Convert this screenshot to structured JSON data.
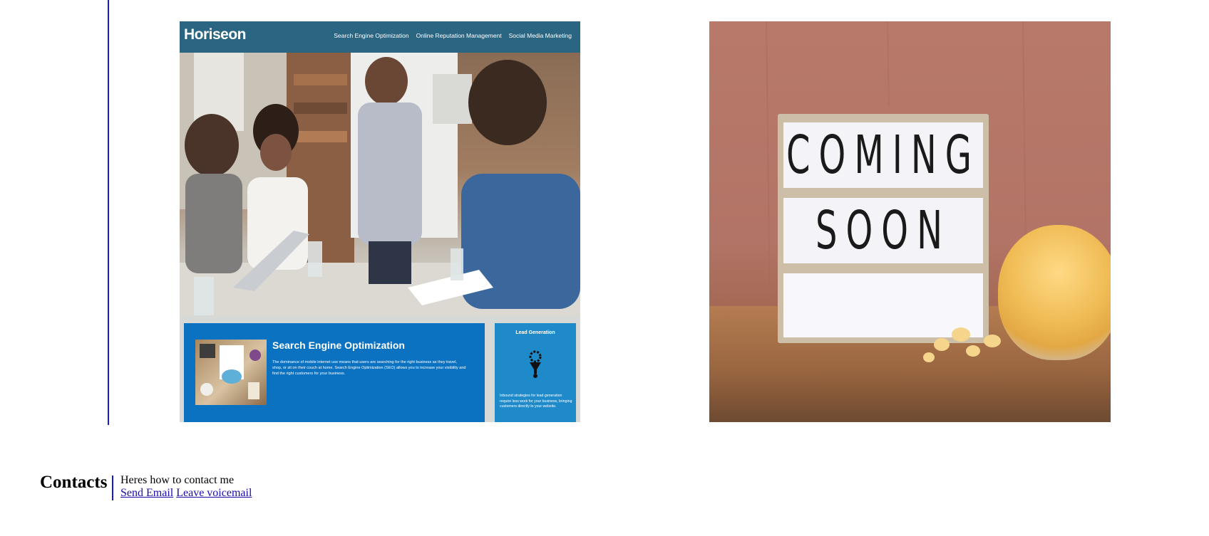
{
  "horiseon": {
    "logo": "Horiseon",
    "nav": [
      "Search Engine Optimization",
      "Online Reputation Management",
      "Social Media Marketing"
    ],
    "seo_title": "Search Engine Optimization",
    "seo_text": "The dominance of mobile internet use means that users are searching for the right business as they travel, shop, or sit on their couch at home. Search Engine Optimization (SEO) allows you to increase your visibility and find the right customers for your business.",
    "lead_title": "Lead Generation",
    "lead_text": "Inbound strategies for lead generation require less work for your business, bringing customers directly to your website."
  },
  "coming_soon": {
    "line1": "COMING",
    "line2": "SOON"
  },
  "contacts": {
    "heading": "Contacts",
    "intro": "Heres how to contact me",
    "email_link": "Send Email",
    "voicemail_link": "Leave voicemail"
  },
  "colors": {
    "border_accent": "#1a1acc",
    "horiseon_header": "#2a6582",
    "horiseon_card": "#0b72c1",
    "link": "#1a0dab"
  }
}
